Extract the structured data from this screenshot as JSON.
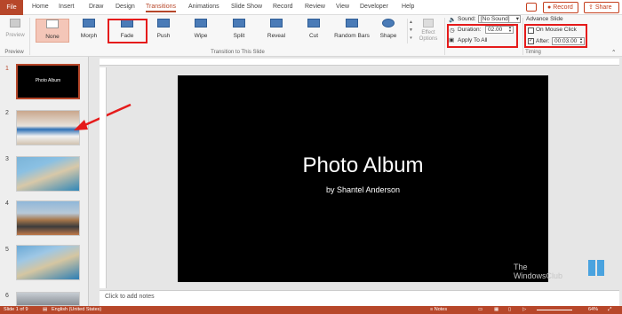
{
  "tabs": [
    "File",
    "Home",
    "Insert",
    "Draw",
    "Design",
    "Transitions",
    "Animations",
    "Slide Show",
    "Record",
    "Review",
    "View",
    "Developer",
    "Help"
  ],
  "ribbon_right": {
    "record": "Record",
    "share": "Share"
  },
  "preview": {
    "label": "Preview",
    "group": "Preview"
  },
  "transitions": [
    "None",
    "Morph",
    "Fade",
    "Push",
    "Wipe",
    "Split",
    "Reveal",
    "Cut",
    "Random Bars",
    "Shape"
  ],
  "effect_options": "Effect Options",
  "group_transition": "Transition to This Slide",
  "timing": {
    "sound_label": "Sound:",
    "sound_value": "[No Sound]",
    "duration_label": "Duration:",
    "duration_value": "02.00",
    "apply_all": "Apply To All",
    "group": "Timing"
  },
  "advance": {
    "title": "Advance Slide",
    "on_click": "On Mouse Click",
    "after_label": "After:",
    "after_value": "00:03.00"
  },
  "slides": [
    "1",
    "2",
    "3",
    "4",
    "5",
    "6"
  ],
  "slide": {
    "title": "Photo Album",
    "subtitle": "by Shantel Anderson"
  },
  "notes_placeholder": "Click to add notes",
  "watermark": {
    "line1": "The",
    "line2": "WindowsClub"
  },
  "status": {
    "slide": "Slide 1 of 9",
    "language": "English (United States)",
    "notes": "Notes",
    "zoom": "64%"
  },
  "colors": {
    "accent": "#b7472a",
    "highlight": "#e51b1b"
  }
}
